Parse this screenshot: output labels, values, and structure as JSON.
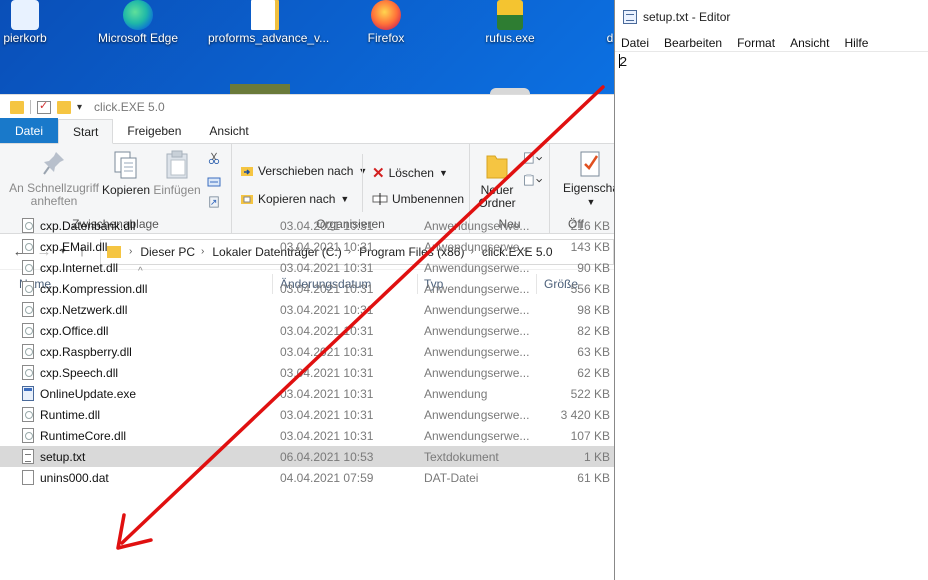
{
  "desktop": {
    "icons": [
      {
        "label": "pierkorb",
        "icon": "recycle-bin-icon",
        "color": "#e8f2ff"
      },
      {
        "label": "Microsoft Edge",
        "icon": "edge-icon",
        "color": "#1fb8a8"
      },
      {
        "label": "proforms_advance_v...",
        "icon": "document-icon",
        "color": "#ffffff"
      },
      {
        "label": "Firefox",
        "icon": "firefox-icon",
        "color": "#ff7139"
      },
      {
        "label": "rufus.exe",
        "icon": "usb-icon",
        "color": "#2e7d32"
      },
      {
        "label": "d",
        "icon": "folder-icon",
        "color": "#f5c542"
      }
    ]
  },
  "explorer": {
    "title": "click.EXE 5.0",
    "tabs": [
      {
        "label": "Datei"
      },
      {
        "label": "Start"
      },
      {
        "label": "Freigeben"
      },
      {
        "label": "Ansicht"
      }
    ],
    "ribbon": {
      "clipboard": {
        "pin_label_1": "An Schnellzugriff",
        "pin_label_2": "anheften",
        "copy_label": "Kopieren",
        "paste_label": "Einfügen",
        "group_name": "Zwischenablage"
      },
      "organize": {
        "move_label": "Verschieben nach",
        "copy_to_label": "Kopieren nach",
        "delete_label": "Löschen",
        "rename_label": "Umbenennen",
        "group_name": "Organisieren"
      },
      "new": {
        "folder_label_1": "Neuer",
        "folder_label_2": "Ordner",
        "group_name": "Neu"
      },
      "open": {
        "properties_label": "Eigenscha",
        "group_name": "Öff"
      }
    },
    "breadcrumbs": [
      "Dieser PC",
      "Lokaler Datenträger (C:)",
      "Program Files (x86)",
      "click.EXE 5.0"
    ],
    "columns": {
      "name": "Name",
      "date": "Änderungsdatum",
      "type": "Typ",
      "size": "Größe"
    },
    "files": [
      {
        "name": "cxp.Datenbank.dll",
        "date": "03.04.2021 10:31",
        "type": "Anwendungserwe...",
        "size": "216 KB",
        "kind": "dll"
      },
      {
        "name": "cxp.EMail.dll",
        "date": "03.04.2021 10:31",
        "type": "Anwendungserwe...",
        "size": "143 KB",
        "kind": "dll"
      },
      {
        "name": "cxp.Internet.dll",
        "date": "03.04.2021 10:31",
        "type": "Anwendungserwe...",
        "size": "90 KB",
        "kind": "dll"
      },
      {
        "name": "cxp.Kompression.dll",
        "date": "03.04.2021 10:31",
        "type": "Anwendungserwe...",
        "size": "556 KB",
        "kind": "dll"
      },
      {
        "name": "cxp.Netzwerk.dll",
        "date": "03.04.2021 10:31",
        "type": "Anwendungserwe...",
        "size": "98 KB",
        "kind": "dll"
      },
      {
        "name": "cxp.Office.dll",
        "date": "03.04.2021 10:31",
        "type": "Anwendungserwe...",
        "size": "82 KB",
        "kind": "dll"
      },
      {
        "name": "cxp.Raspberry.dll",
        "date": "03.04.2021 10:31",
        "type": "Anwendungserwe...",
        "size": "63 KB",
        "kind": "dll"
      },
      {
        "name": "cxp.Speech.dll",
        "date": "03.04.2021 10:31",
        "type": "Anwendungserwe...",
        "size": "62 KB",
        "kind": "dll"
      },
      {
        "name": "OnlineUpdate.exe",
        "date": "03.04.2021 10:31",
        "type": "Anwendung",
        "size": "522 KB",
        "kind": "exe"
      },
      {
        "name": "Runtime.dll",
        "date": "03.04.2021 10:31",
        "type": "Anwendungserwe...",
        "size": "3 420 KB",
        "kind": "dll"
      },
      {
        "name": "RuntimeCore.dll",
        "date": "03.04.2021 10:31",
        "type": "Anwendungserwe...",
        "size": "107 KB",
        "kind": "dll"
      },
      {
        "name": "setup.txt",
        "date": "06.04.2021 10:53",
        "type": "Textdokument",
        "size": "1 KB",
        "kind": "txt",
        "selected": true
      },
      {
        "name": "unins000.dat",
        "date": "04.04.2021 07:59",
        "type": "DAT-Datei",
        "size": "61 KB",
        "kind": "dat"
      }
    ]
  },
  "notepad": {
    "title": "setup.txt - Editor",
    "menu": [
      "Datei",
      "Bearbeiten",
      "Format",
      "Ansicht",
      "Hilfe"
    ],
    "content": "2"
  },
  "annotation": {
    "color": "#e01010"
  }
}
